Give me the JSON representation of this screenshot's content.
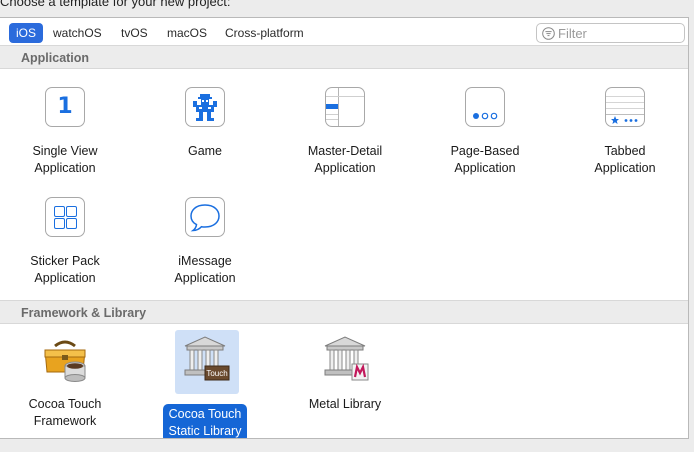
{
  "heading": "Choose a template for your new project:",
  "tabs": [
    {
      "label": "iOS",
      "selected": true
    },
    {
      "label": "watchOS",
      "selected": false
    },
    {
      "label": "tvOS",
      "selected": false
    },
    {
      "label": "macOS",
      "selected": false
    },
    {
      "label": "Cross-platform",
      "selected": false
    }
  ],
  "filter": {
    "placeholder": "Filter",
    "value": ""
  },
  "sections": [
    {
      "title": "Application",
      "items": [
        {
          "line1": "Single View",
          "line2": "Application",
          "icon": "single-view-icon"
        },
        {
          "line1": "Game",
          "line2": "",
          "icon": "game-icon"
        },
        {
          "line1": "Master-Detail",
          "line2": "Application",
          "icon": "master-detail-icon"
        },
        {
          "line1": "Page-Based",
          "line2": "Application",
          "icon": "page-based-icon"
        },
        {
          "line1": "Tabbed",
          "line2": "Application",
          "icon": "tabbed-icon"
        },
        {
          "line1": "Sticker Pack",
          "line2": "Application",
          "icon": "sticker-pack-icon"
        },
        {
          "line1": "iMessage",
          "line2": "Application",
          "icon": "imessage-icon"
        }
      ]
    },
    {
      "title": "Framework & Library",
      "items": [
        {
          "line1": "Cocoa Touch",
          "line2": "Framework",
          "icon": "toolbox-icon"
        },
        {
          "line1": "Cocoa Touch",
          "line2": "Static Library",
          "icon": "building-touch-icon",
          "selected": true,
          "badge": "Touch"
        },
        {
          "line1": "Metal Library",
          "line2": "",
          "icon": "building-metal-icon"
        }
      ]
    }
  ],
  "single_view_glyph": "1",
  "colors": {
    "accent": "#1566d6",
    "tab_selected": "#2b6bdc",
    "icon_blue": "#1a6fe0"
  }
}
